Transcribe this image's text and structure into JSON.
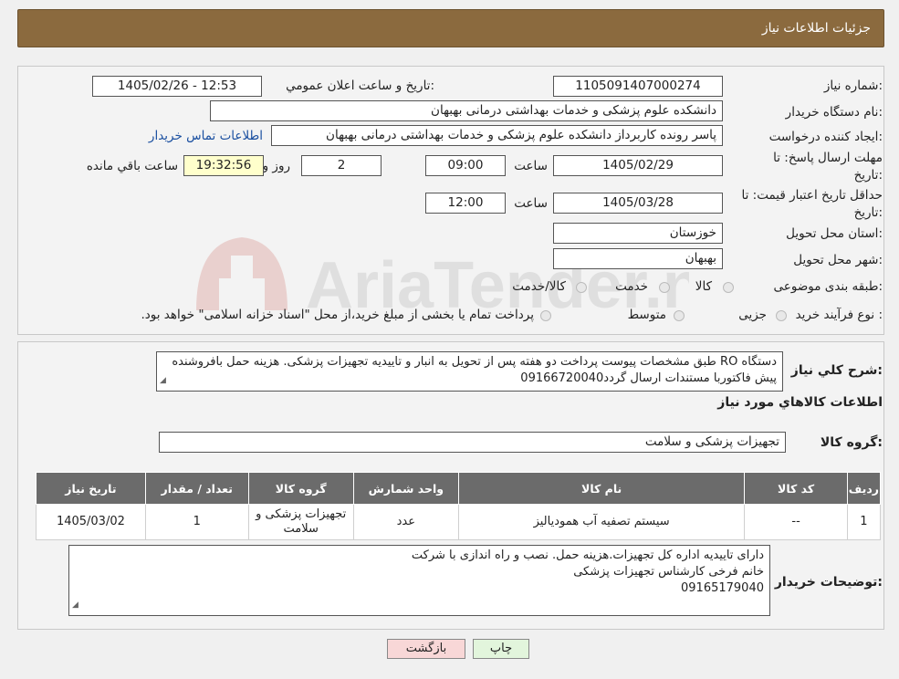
{
  "header": {
    "title": "جزئیات اطلاعات نیاز"
  },
  "form": {
    "need_number_label": "شماره نیاز:",
    "need_number": "1105091407000274",
    "announce_label": "تاریخ و ساعت اعلان عمومي:",
    "announce_value": "1405/02/26 - 12:53",
    "buyer_label": "نام دستگاه خریدار:",
    "buyer_value": "دانشکده علوم پزشکی و خدمات بهداشتی  درمانی بهبهان",
    "creator_label": "ایجاد کننده درخواست:",
    "creator_value": "پاسر رونده کاربرداز دانشکده علوم پزشکی و خدمات بهداشتی  درمانی بهبهان",
    "contact_link": "اطلاعات تماس خریدار",
    "deadline_label": "مهلت ارسال پاسخ: تا تاریخ:",
    "deadline_date": "1405/02/29",
    "time_word": "ساعت",
    "deadline_time": "09:00",
    "days_value": "2",
    "days_word": "روز و",
    "remaining_time": "19:32:56",
    "remaining_word": "ساعت باقي مانده",
    "validity_label": "حداقل تاریخ اعتبار قیمت: تا تاریخ:",
    "validity_date": "1405/03/28",
    "validity_time": "12:00",
    "province_label": "استان محل تحویل:",
    "province_value": "خوزستان",
    "city_label": "شهر محل تحویل:",
    "city_value": "بهبهان",
    "category_label": "طبقه بندی موضوعی:",
    "category_options": [
      "کالا",
      "خدمت",
      "کالا/خدمت"
    ],
    "process_label": "نوع فرآیند خرید :",
    "process_options": [
      "جزیی",
      "متوسط"
    ],
    "process_note": "پرداخت تمام یا بخشی از مبلغ خرید،از محل \"اسناد خزانه اسلامی\" خواهد بود."
  },
  "details": {
    "summary_label": "شرح کلي نیاز:",
    "summary_text": "دستگاه RO طبق مشخصات پیوست پرداخت دو هفته پس از تحویل به انبار و تاییدیه تجهیزات پزشکی. هزینه حمل بافروشنده پیش فاکتوربا مستندات ارسال گردد09166720040",
    "goods_info_title": "اطلاعات کالاهاي مورد نیاز",
    "group_label": "گروه کالا:",
    "group_value": "تجهیزات پزشکی و سلامت",
    "table": {
      "headers": [
        "ردیف",
        "کد کالا",
        "نام کالا",
        "واحد شمارش",
        "گروه کالا",
        "تعداد / مقدار",
        "تاریخ نیاز"
      ],
      "rows": [
        [
          "1",
          "--",
          "سیستم تصفیه آب همودیالیز",
          "عدد",
          "تجهیزات پزشکی و سلامت",
          "1",
          "1405/03/02"
        ]
      ]
    },
    "buyer_notes_label": "توضیحات خریدار:",
    "buyer_notes_lines": [
      "دارای تاییدیه اداره کل تجهیزات.هزینه حمل. نصب و راه اندازی با شرکت",
      "خانم فرخی کارشناس تجهیزات پزشکی",
      "09165179040"
    ]
  },
  "buttons": {
    "print": "چاپ",
    "back": "بازگشت"
  },
  "watermark": "AriaTender.neT",
  "colors": {
    "header_bg": "#8b6a3e",
    "table_header_bg": "#6b6b6b",
    "back_btn_bg": "#f8d7d7",
    "print_btn_bg": "#e2f5dc"
  }
}
